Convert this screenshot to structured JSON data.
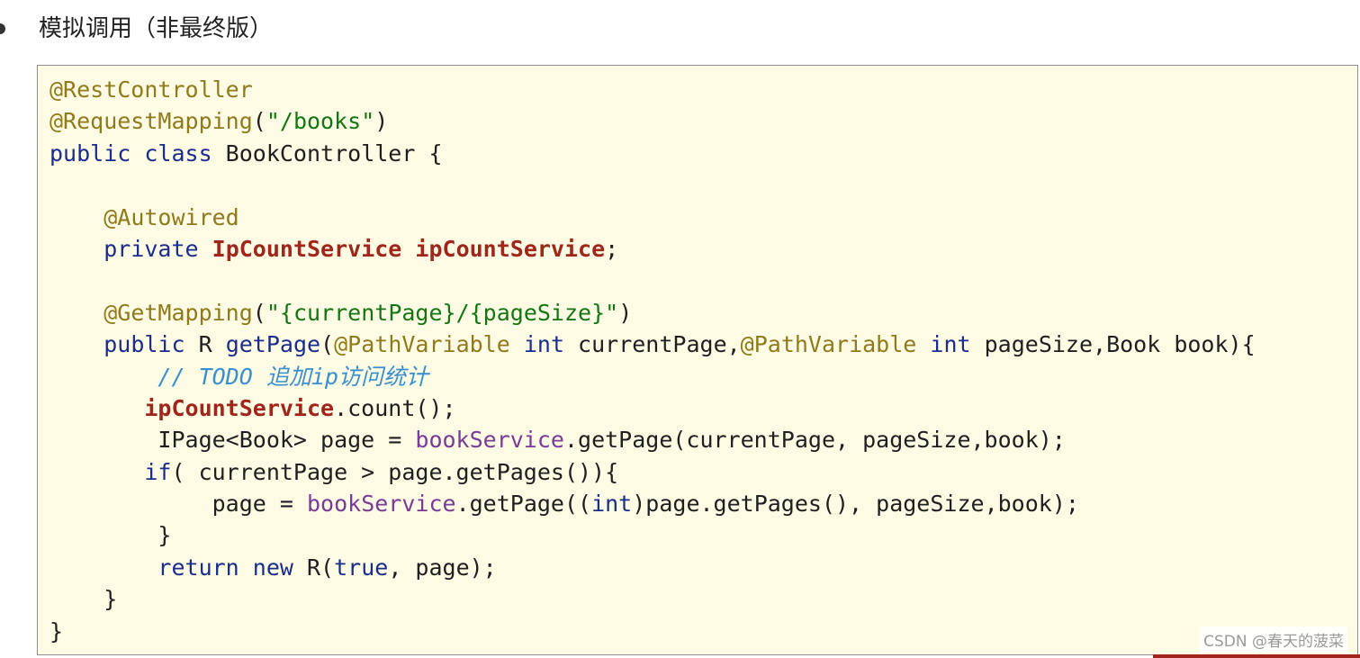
{
  "heading": "模拟调用（非最终版）",
  "watermark": "CSDN @春天的菠菜",
  "code_lines": [
    [
      [
        "ann",
        "@RestController"
      ]
    ],
    [
      [
        "ann",
        "@RequestMapping"
      ],
      [
        "plain",
        "("
      ],
      [
        "str",
        "\"/books\""
      ],
      [
        "plain",
        ")"
      ]
    ],
    [
      [
        "kw",
        "public class"
      ],
      [
        "plain",
        " BookController {"
      ]
    ],
    [],
    [
      [
        "plain",
        "    "
      ],
      [
        "ann",
        "@Autowired"
      ]
    ],
    [
      [
        "plain",
        "    "
      ],
      [
        "kw",
        "private"
      ],
      [
        "plain",
        " "
      ],
      [
        "field",
        "IpCountService"
      ],
      [
        "plain",
        " "
      ],
      [
        "field",
        "ipCountService"
      ],
      [
        "plain",
        ";"
      ]
    ],
    [],
    [
      [
        "plain",
        "    "
      ],
      [
        "ann",
        "@GetMapping"
      ],
      [
        "plain",
        "("
      ],
      [
        "str",
        "\"{currentPage}/{pageSize}\""
      ],
      [
        "plain",
        ")"
      ]
    ],
    [
      [
        "plain",
        "    "
      ],
      [
        "kw",
        "public"
      ],
      [
        "plain",
        " R "
      ],
      [
        "kw",
        "getPage"
      ],
      [
        "plain",
        "("
      ],
      [
        "ann",
        "@PathVariable"
      ],
      [
        "plain",
        " "
      ],
      [
        "kw",
        "int"
      ],
      [
        "plain",
        " currentPage,"
      ],
      [
        "ann",
        "@PathVariable"
      ],
      [
        "plain",
        " "
      ],
      [
        "kw",
        "int"
      ],
      [
        "plain",
        " pageSize,Book book){"
      ]
    ],
    [
      [
        "plain",
        "        "
      ],
      [
        "comment",
        "// TODO 追加ip访问统计"
      ]
    ],
    [
      [
        "plain",
        "       "
      ],
      [
        "field",
        "ipCountService"
      ],
      [
        "plain",
        ".count();"
      ]
    ],
    [
      [
        "plain",
        "        IPage<Book> page = "
      ],
      [
        "svc",
        "bookService"
      ],
      [
        "plain",
        ".getPage(currentPage, pageSize,book);"
      ]
    ],
    [
      [
        "plain",
        "       "
      ],
      [
        "kw",
        "if"
      ],
      [
        "plain",
        "( currentPage > page.getPages()){"
      ]
    ],
    [
      [
        "plain",
        "            page = "
      ],
      [
        "svc",
        "bookService"
      ],
      [
        "plain",
        ".getPage(("
      ],
      [
        "kw",
        "int"
      ],
      [
        "plain",
        ")page.getPages(), pageSize,book);"
      ]
    ],
    [
      [
        "plain",
        "        }"
      ]
    ],
    [
      [
        "plain",
        "        "
      ],
      [
        "kw",
        "return new"
      ],
      [
        "plain",
        " R("
      ],
      [
        "kw",
        "true"
      ],
      [
        "plain",
        ", page);"
      ]
    ],
    [
      [
        "plain",
        "    }"
      ]
    ],
    [
      [
        "plain",
        "}"
      ]
    ]
  ]
}
